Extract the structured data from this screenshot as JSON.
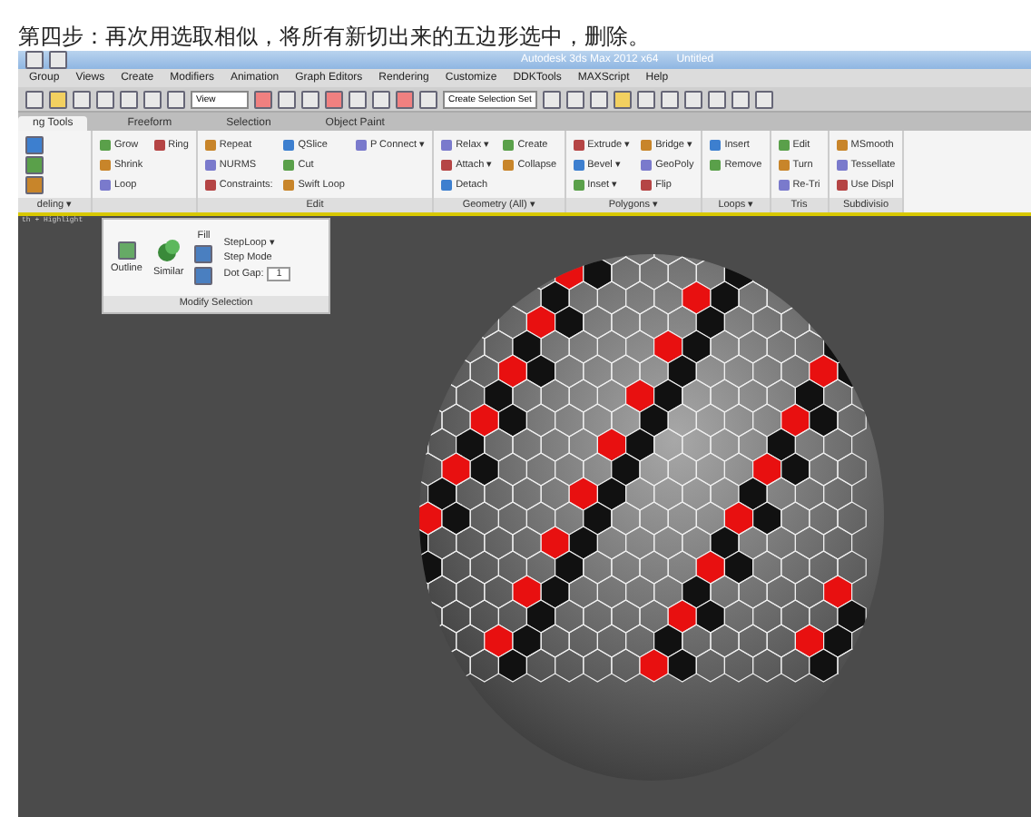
{
  "heading": "第四步：再次用选取相似，将所有新切出来的五边形选中，删除。",
  "window": {
    "title": "Autodesk 3ds Max  2012 x64",
    "document": "Untitled"
  },
  "menu": [
    "Group",
    "Views",
    "Create",
    "Modifiers",
    "Animation",
    "Graph Editors",
    "Rendering",
    "Customize",
    "DDKTools",
    "MAXScript",
    "Help"
  ],
  "toolbar": {
    "view_dropdown": "View",
    "selection_set": "Create Selection Set"
  },
  "ribbon_tabs": [
    {
      "label": "ng Tools",
      "selected": true
    },
    {
      "label": "Freeform",
      "selected": false
    },
    {
      "label": "Selection",
      "selected": false
    },
    {
      "label": "Object Paint",
      "selected": false
    }
  ],
  "ribbon_groups": [
    {
      "label": "deling ▾"
    },
    {
      "items": [
        {
          "label": "Grow"
        },
        {
          "label": "Shrink"
        },
        {
          "label": "Loop"
        },
        {
          "label": "Ring"
        }
      ]
    },
    {
      "label": "Edit",
      "items": [
        {
          "label": "Repeat"
        },
        {
          "label": "NURMS"
        },
        {
          "label": "Constraints:"
        },
        {
          "label": "QSlice"
        },
        {
          "label": "Cut"
        },
        {
          "label": "Swift Loop"
        },
        {
          "label": "P Connect ▾"
        }
      ]
    },
    {
      "label": "Geometry (All) ▾",
      "items": [
        {
          "label": "Relax ▾"
        },
        {
          "label": "Attach ▾"
        },
        {
          "label": "Detach"
        },
        {
          "label": "Create"
        },
        {
          "label": "Collapse"
        }
      ]
    },
    {
      "label": "Polygons ▾",
      "items": [
        {
          "label": "Extrude ▾"
        },
        {
          "label": "Bevel ▾"
        },
        {
          "label": "Inset ▾"
        },
        {
          "label": "Bridge ▾"
        },
        {
          "label": "GeoPoly"
        },
        {
          "label": "Flip"
        }
      ]
    },
    {
      "label": "Loops ▾",
      "items": [
        {
          "label": "Insert"
        },
        {
          "label": "Remove"
        }
      ]
    },
    {
      "label": "Tris",
      "items": [
        {
          "label": "Edit"
        },
        {
          "label": "Turn"
        },
        {
          "label": "Re-Tri"
        }
      ]
    },
    {
      "label": "Subdivisio",
      "items": [
        {
          "label": "MSmooth"
        },
        {
          "label": "Tessellate"
        },
        {
          "label": "Use Displ"
        }
      ]
    }
  ],
  "viewport": {
    "label": "th + Highlight"
  },
  "popup": {
    "title": "Modify Selection",
    "outline": "Outline",
    "similar": "Similar",
    "fill": "Fill",
    "step_loop": "StepLoop ▾",
    "step_mode": "Step Mode",
    "dot_gap_label": "Dot Gap:",
    "dot_gap": "1"
  }
}
